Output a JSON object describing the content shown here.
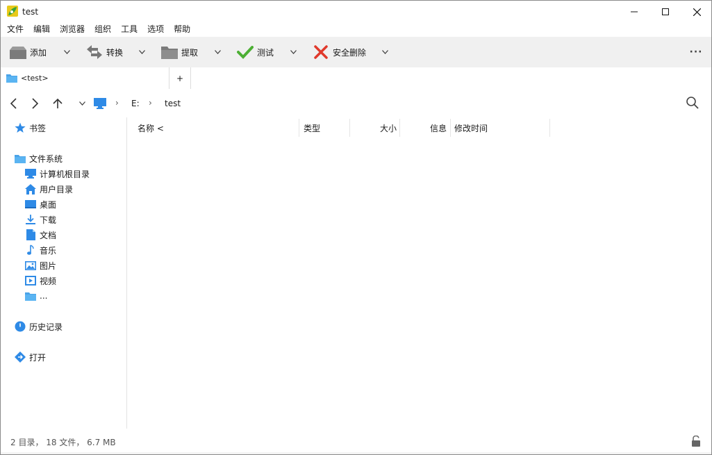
{
  "window": {
    "title": "test"
  },
  "menu": [
    "文件",
    "编辑",
    "浏览器",
    "组织",
    "工具",
    "选项",
    "帮助"
  ],
  "toolbar": {
    "add_label": "添加",
    "convert_label": "转换",
    "extract_label": "提取",
    "test_label": "测试",
    "secure_delete_label": "安全删除",
    "more_label": "···"
  },
  "tabs": [
    {
      "label": "<test>"
    }
  ],
  "tab_add_label": "+",
  "address": {
    "drive": "E:",
    "folder": "test"
  },
  "sidebar": {
    "bookmarks": "书签",
    "filesystem": "文件系统",
    "items": [
      {
        "label": "计算机根目录",
        "icon": "computer-icon"
      },
      {
        "label": "用户目录",
        "icon": "home-icon"
      },
      {
        "label": "桌面",
        "icon": "desktop-icon"
      },
      {
        "label": "下载",
        "icon": "download-icon"
      },
      {
        "label": "文档",
        "icon": "document-icon"
      },
      {
        "label": "音乐",
        "icon": "music-icon"
      },
      {
        "label": "图片",
        "icon": "picture-icon"
      },
      {
        "label": "视频",
        "icon": "video-icon"
      },
      {
        "label": "...",
        "icon": "folder-icon"
      }
    ],
    "history": "历史记录",
    "open": "打开"
  },
  "columns": {
    "name": "名称 <",
    "type": "类型",
    "size": "大小",
    "info": "信息",
    "mtime": "修改时间"
  },
  "status": {
    "text": "2 目录， 18 文件， 6.7 MB"
  },
  "colors": {
    "accent": "#2e8ae6",
    "toolbar_bg": "#f0f0f0",
    "check_green": "#4caf34",
    "delete_red": "#e0392b"
  }
}
